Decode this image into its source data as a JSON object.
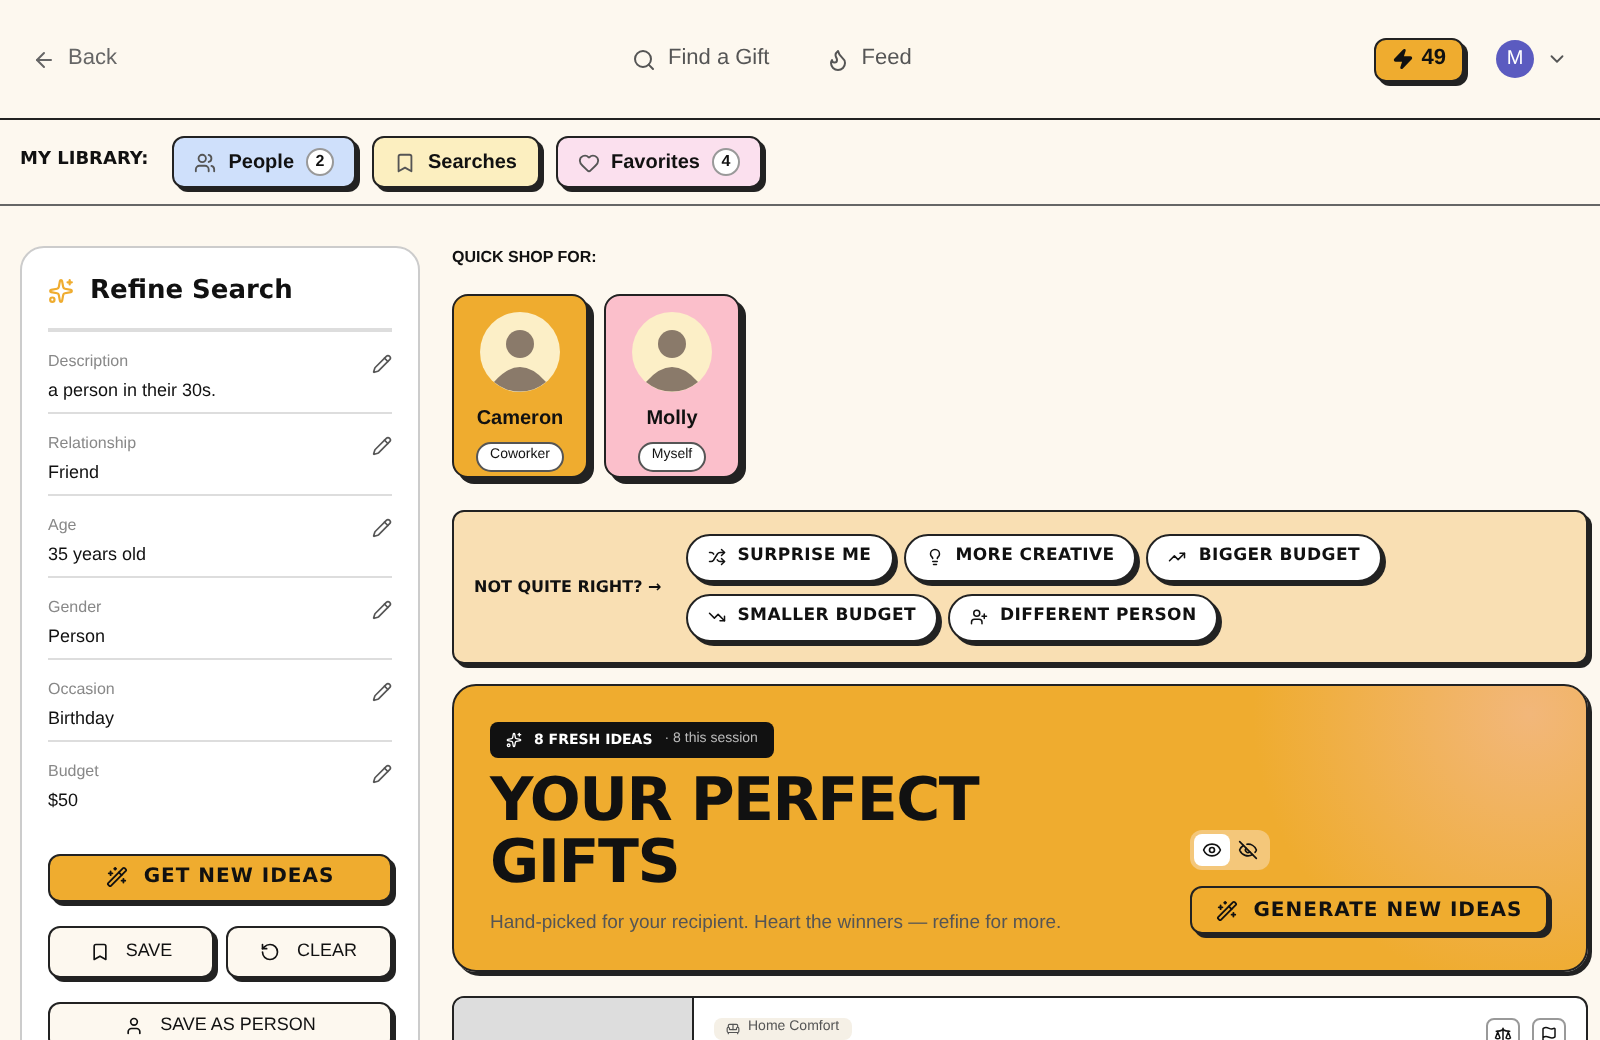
{
  "header": {
    "back": "Back",
    "nav": [
      {
        "label": "Find a Gift",
        "kind": "search"
      },
      {
        "label": "Feed",
        "kind": "flame"
      }
    ],
    "credits": "49",
    "avatar": "M"
  },
  "library": {
    "label": "MY LIBRARY:",
    "tabs": [
      {
        "label": "People",
        "count": "2",
        "kind": "people",
        "color": "#cfe0fb"
      },
      {
        "label": "Searches",
        "kind": "bookmark",
        "color": "#fcefc0"
      },
      {
        "label": "Favorites",
        "count": "4",
        "kind": "heart",
        "color": "#fbe0ee"
      }
    ]
  },
  "refine": {
    "title": "Refine Search",
    "fields": [
      {
        "label": "Description",
        "value": "a person in their 30s."
      },
      {
        "label": "Relationship",
        "value": "Friend"
      },
      {
        "label": "Age",
        "value": "35 years old"
      },
      {
        "label": "Gender",
        "value": "Person"
      },
      {
        "label": "Occasion",
        "value": "Birthday"
      },
      {
        "label": "Budget",
        "value": "$50"
      }
    ],
    "primary": "GET NEW IDEAS",
    "save": "SAVE",
    "clear": "CLEAR",
    "save_person": "SAVE AS PERSON"
  },
  "quick_shop": {
    "label": "QUICK SHOP FOR:",
    "people": [
      {
        "name": "Cameron",
        "tag": "Coworker",
        "color": "#efac2f"
      },
      {
        "name": "Molly",
        "tag": "Myself",
        "color": "#fbbfcb"
      }
    ]
  },
  "not_quite": {
    "label": "NOT QUITE RIGHT? →",
    "options": [
      {
        "label": "SURPRISE ME",
        "kind": "shuffle"
      },
      {
        "label": "MORE CREATIVE",
        "kind": "bulb"
      },
      {
        "label": "BIGGER BUDGET",
        "kind": "up"
      },
      {
        "label": "SMALLER BUDGET",
        "kind": "down"
      },
      {
        "label": "DIFFERENT PERSON",
        "kind": "person"
      }
    ]
  },
  "hero": {
    "badge": "8 FRESH IDEAS",
    "session": "· 8 this session",
    "title_lines": [
      "YOUR PERFECT",
      "GIFTS"
    ],
    "subtitle": "Hand-picked for your recipient. Heart the winners — refine for more.",
    "view_toggle": [
      {
        "kind": "show",
        "selected": true
      },
      {
        "kind": "hide",
        "selected": false
      }
    ],
    "generate": "GENERATE NEW IDEAS"
  },
  "product": {
    "category": "Home Comfort"
  }
}
